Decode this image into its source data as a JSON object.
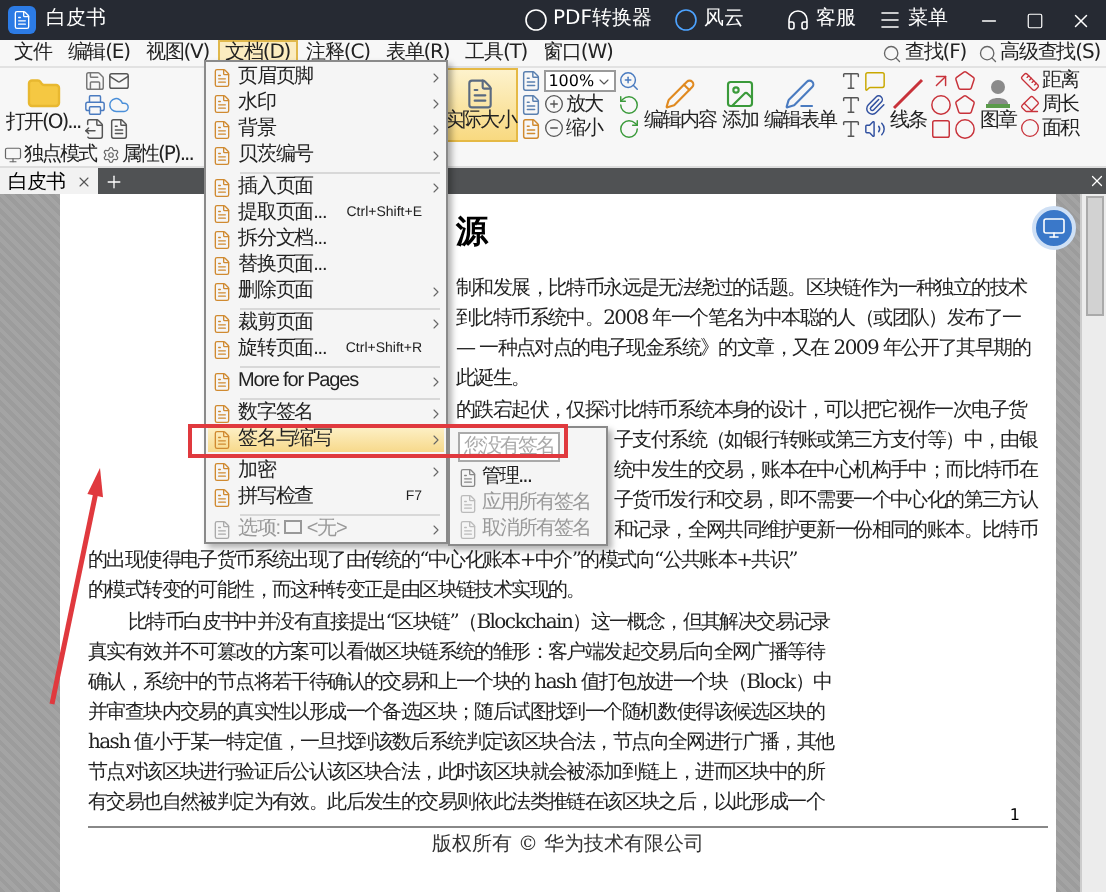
{
  "window": {
    "title": "白皮书",
    "actions": [
      {
        "label": "PDF转换器"
      },
      {
        "label": "风云"
      },
      {
        "label": "客服"
      },
      {
        "label": "菜单"
      }
    ]
  },
  "menu_bar": {
    "items": [
      {
        "label": "文件",
        "selected": false
      },
      {
        "label": "编辑(E)",
        "selected": false
      },
      {
        "label": "视图(V)",
        "selected": false
      },
      {
        "label": "文档(D)",
        "selected": true
      },
      {
        "label": "注释(C)",
        "selected": false
      },
      {
        "label": "表单(R)",
        "selected": false
      },
      {
        "label": "工具(T)",
        "selected": false
      },
      {
        "label": "窗口(W)",
        "selected": false
      }
    ],
    "search_buttons": [
      "查找(F)",
      "高级查找(S)"
    ]
  },
  "ribbon": {
    "open": "打开(O)...",
    "actual_size": {
      "label": "实际大小",
      "selected": true
    },
    "zoom": {
      "value": "100%",
      "zoom_in": "放大",
      "zoom_out": "缩小"
    },
    "edit_content": "编辑内容",
    "add": "添加",
    "edit_form": "编辑表单",
    "line": "线条",
    "stamp": "图章",
    "measure": [
      "距离",
      "周长",
      "面积"
    ],
    "mode": "独点模式",
    "properties": "属性(P)..."
  },
  "tabs": [
    {
      "label": "白皮书",
      "selected": true
    }
  ],
  "document_menu": {
    "groups": [
      [
        {
          "label": "页眉页脚",
          "submenu": true,
          "highlighted": false,
          "disabled": false
        },
        {
          "label": "水印",
          "submenu": true,
          "highlighted": false,
          "disabled": false
        },
        {
          "label": "背景",
          "submenu": true,
          "highlighted": false,
          "disabled": false
        },
        {
          "label": "贝茨编号",
          "submenu": true,
          "highlighted": false,
          "disabled": false
        }
      ],
      [
        {
          "label": "插入页面",
          "submenu": true,
          "highlighted": false,
          "disabled": false
        },
        {
          "label": "提取页面...",
          "shortcut": "Ctrl+Shift+E",
          "submenu": false,
          "highlighted": false,
          "disabled": false
        },
        {
          "label": "拆分文档...",
          "submenu": false,
          "highlighted": false,
          "disabled": false
        },
        {
          "label": "替换页面...",
          "submenu": false,
          "highlighted": false,
          "disabled": false
        },
        {
          "label": "删除页面",
          "submenu": true,
          "highlighted": false,
          "disabled": false
        }
      ],
      [
        {
          "label": "裁剪页面",
          "submenu": true,
          "highlighted": false,
          "disabled": false
        },
        {
          "label": "旋转页面...",
          "shortcut": "Ctrl+Shift+R",
          "submenu": false,
          "highlighted": false,
          "disabled": false
        }
      ],
      [
        {
          "label": "More for Pages",
          "submenu": true,
          "highlighted": false,
          "disabled": false
        }
      ],
      [
        {
          "label": "数字签名",
          "submenu": true,
          "highlighted": false,
          "disabled": false
        },
        {
          "label": "签名与缩写",
          "submenu": true,
          "highlighted": true,
          "disabled": false
        }
      ],
      [
        {
          "label": "加密",
          "submenu": true,
          "highlighted": false,
          "disabled": false
        },
        {
          "label": "拼写检查",
          "shortcut": "F7",
          "submenu": false,
          "highlighted": false,
          "disabled": false
        }
      ],
      [
        {
          "label": "选项:",
          "value": "<无>",
          "submenu": true,
          "highlighted": false,
          "disabled": true
        }
      ]
    ]
  },
  "signature_submenu": {
    "items": [
      {
        "kind": "field",
        "label": "您没有签名",
        "disabled": true
      },
      {
        "kind": "item",
        "label": "管理...",
        "disabled": false
      },
      {
        "kind": "item",
        "label": "应用所有签名",
        "disabled": true
      },
      {
        "kind": "item",
        "label": "取消所有签名",
        "disabled": true
      }
    ]
  },
  "document": {
    "heading": "源",
    "paragraphs": [
      {
        "lines": [
          {
            "kind": "cut",
            "text": "制和发展，比特币永远是无法绕过的话题。区块链作为一种独立的技术"
          },
          {
            "kind": "cut",
            "text": "到比特币系统中。2008 年一个笔名为中本聪的人（或团队）发布了一"
          },
          {
            "kind": "cut",
            "text": "— 一种点对点的电子现金系统》的文章，又在 2009 年公开了其早期的"
          },
          {
            "kind": "cut",
            "text": "此诞生。"
          }
        ]
      },
      {
        "lines": [
          {
            "kind": "cut",
            "text": "的跌宕起伏，仅探讨比特币系统本身的设计，可以把它视作一次电子货"
          },
          {
            "kind": "cut_submenu",
            "text": "子支付系统（如银行转账或第三方支付等）中，由银"
          },
          {
            "kind": "cut_submenu",
            "text": "统中发生的交易，账本在中心机构手中；而比特币在"
          },
          {
            "kind": "cut_submenu",
            "text": "子货币发行和交易，即不需要一个中心化的第三方认"
          },
          {
            "kind": "cut_submenu",
            "text": "和记录，全网共同维护更新一份相同的账本。比特币"
          },
          {
            "kind": "full",
            "text": "的出现使得电子货币系统出现了由传统的“中心化账本+中介”的模式向“公共账本+共识”"
          },
          {
            "kind": "full",
            "text": "的模式转变的可能性，而这种转变正是由区块链技术实现的。"
          }
        ]
      },
      {
        "lines": [
          {
            "kind": "indent",
            "text": "比特币白皮书中并没有直接提出“区块链”（Blockchain）这一概念，但其解决交易记录"
          },
          {
            "kind": "full",
            "text": "真实有效并不可篡改的方案可以看做区块链系统的雏形：客户端发起交易后向全网广播等待"
          },
          {
            "kind": "full",
            "text": "确认，系统中的节点将若干待确认的交易和上一个块的 hash 值打包放进一个块（Block）中"
          },
          {
            "kind": "full",
            "text": "并审查块内交易的真实性以形成一个备选区块；随后试图找到一个随机数使得该候选区块的"
          },
          {
            "kind": "full",
            "text": "hash 值小于某一特定值，一旦找到该数后系统判定该区块合法，节点向全网进行广播，其他"
          },
          {
            "kind": "full",
            "text": "节点对该区块进行验证后公认该区块合法，此时该区块就会被添加到链上，进而区块中的所"
          },
          {
            "kind": "full",
            "text": "有交易也自然被判定为有效。此后发生的交易则依此法类推链在该区块之后，以此形成一个"
          }
        ]
      }
    ],
    "footer": "版权所有 © 华为技术有限公司",
    "page_number": "1"
  }
}
